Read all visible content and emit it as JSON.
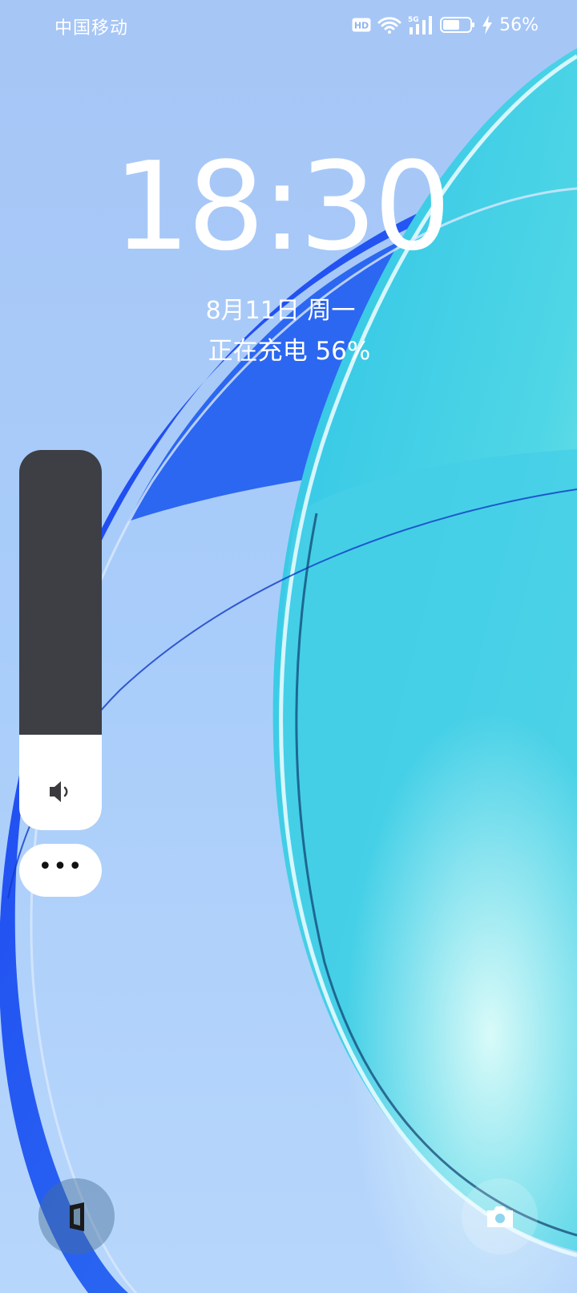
{
  "status_bar": {
    "carrier": "中国移动",
    "hd_badge": "HD",
    "network": "5G",
    "battery_percent": "56%",
    "icons": [
      "hd-icon",
      "wifi-icon",
      "signal-5g-icon",
      "battery-icon",
      "charging-bolt-icon"
    ]
  },
  "lockscreen": {
    "time": "18:30",
    "date": "8月11日 周一",
    "charging_status": "正在充电 56%"
  },
  "volume_panel": {
    "level": 0.25,
    "icon": "speaker-icon",
    "more_label": "•••"
  },
  "shortcuts": {
    "left_icon": "app-shortcut-icon",
    "right_icon": "camera-icon"
  },
  "colors": {
    "sky": "#9ec3f7",
    "blue_ribbon": "#1a3cf0",
    "cyan_shape": "#3fd2e0",
    "panel_dark": "#3d3f45"
  }
}
